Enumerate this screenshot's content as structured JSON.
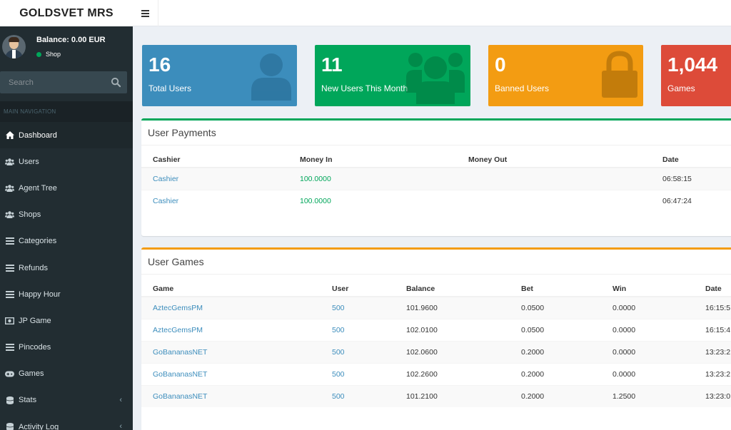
{
  "header": {
    "logo": "GOLDSVET MRS",
    "toggle_icon": "bars-icon"
  },
  "sidebar": {
    "balance": "Balance: 0.00 EUR",
    "status": "Shop",
    "search_placeholder": "Search",
    "nav_header": "MAIN NAVIGATION",
    "items": [
      {
        "label": "Dashboard",
        "icon": "home-icon"
      },
      {
        "label": "Users",
        "icon": "users-icon"
      },
      {
        "label": "Agent Tree",
        "icon": "users-icon"
      },
      {
        "label": "Shops",
        "icon": "users-icon"
      },
      {
        "label": "Categories",
        "icon": "list-icon"
      },
      {
        "label": "Refunds",
        "icon": "list-icon"
      },
      {
        "label": "Happy Hour",
        "icon": "list-icon"
      },
      {
        "label": "JP Game",
        "icon": "money-icon"
      },
      {
        "label": "Pincodes",
        "icon": "list-icon"
      },
      {
        "label": "Games",
        "icon": "gamepad-icon"
      },
      {
        "label": "Stats",
        "icon": "database-icon"
      },
      {
        "label": "Activity Log",
        "icon": "database-icon"
      }
    ]
  },
  "stats": [
    {
      "value": "16",
      "label": "Total Users",
      "color": "#3c8dbc",
      "icon": "user-icon"
    },
    {
      "value": "11",
      "label": "New Users This Month",
      "color": "#00a65a",
      "icon": "users-icon"
    },
    {
      "value": "0",
      "label": "Banned Users",
      "color": "#f39c12",
      "icon": "lock-icon"
    },
    {
      "value": "1,044",
      "label": "Games",
      "color": "#dd4b39",
      "icon": "gamepad-icon"
    }
  ],
  "payments": {
    "title": "User Payments",
    "columns": [
      "Cashier",
      "Money In",
      "Money Out",
      "Date"
    ],
    "rows": [
      [
        "Cashier",
        "100.0000",
        "",
        "06:58:15"
      ],
      [
        "Cashier",
        "100.0000",
        "",
        "06:47:24"
      ]
    ]
  },
  "games": {
    "title": "User Games",
    "columns": [
      "Game",
      "User",
      "Balance",
      "Bet",
      "Win",
      "Date"
    ],
    "rows": [
      [
        "AztecGemsPM",
        "500",
        "101.9600",
        "0.0500",
        "0.0000",
        "16:15:5"
      ],
      [
        "AztecGemsPM",
        "500",
        "102.0100",
        "0.0500",
        "0.0000",
        "16:15:4"
      ],
      [
        "GoBananasNET",
        "500",
        "102.0600",
        "0.2000",
        "0.0000",
        "13:23:2"
      ],
      [
        "GoBananasNET",
        "500",
        "102.2600",
        "0.2000",
        "0.0000",
        "13:23:2"
      ],
      [
        "GoBananasNET",
        "500",
        "101.2100",
        "0.2000",
        "1.2500",
        "13:23:0"
      ]
    ]
  }
}
